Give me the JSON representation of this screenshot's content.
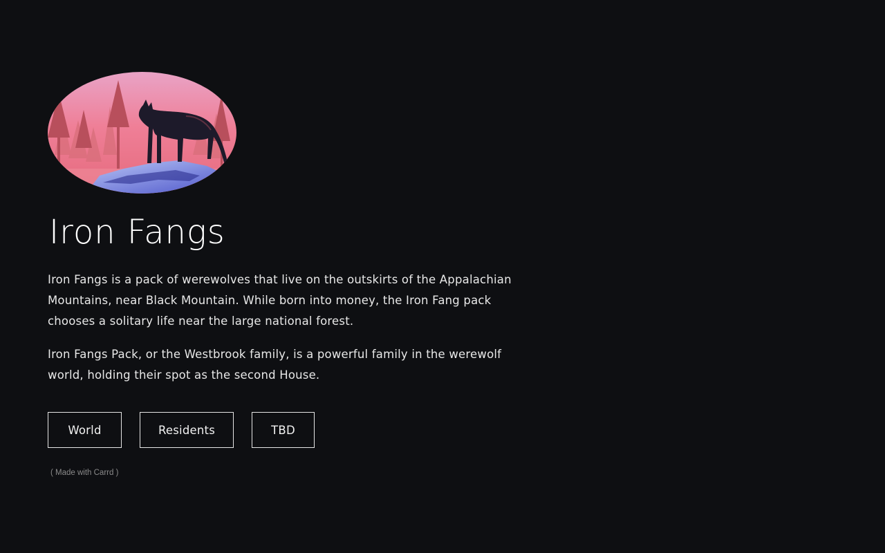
{
  "page": {
    "background_color": "#0e0f12",
    "text_color": "#f2f2f2"
  },
  "hero": {
    "image_icon": "wolf-on-snowy-rock-pink-forest-illustration"
  },
  "title": "Iron Fangs",
  "paragraphs": [
    "Iron Fangs is a pack of werewolves that live on the outskirts of the Appalachian Mountains, near Black Mountain. While born into money, the Iron Fang pack chooses a solitary life near the large national forest.",
    "Iron Fangs Pack, or the Westbrook family, is a powerful family in the werewolf world, holding their spot as the second House."
  ],
  "buttons": [
    {
      "label": "World"
    },
    {
      "label": "Residents"
    },
    {
      "label": "TBD"
    }
  ],
  "footer": {
    "credit": "( Made with Carrd )"
  }
}
